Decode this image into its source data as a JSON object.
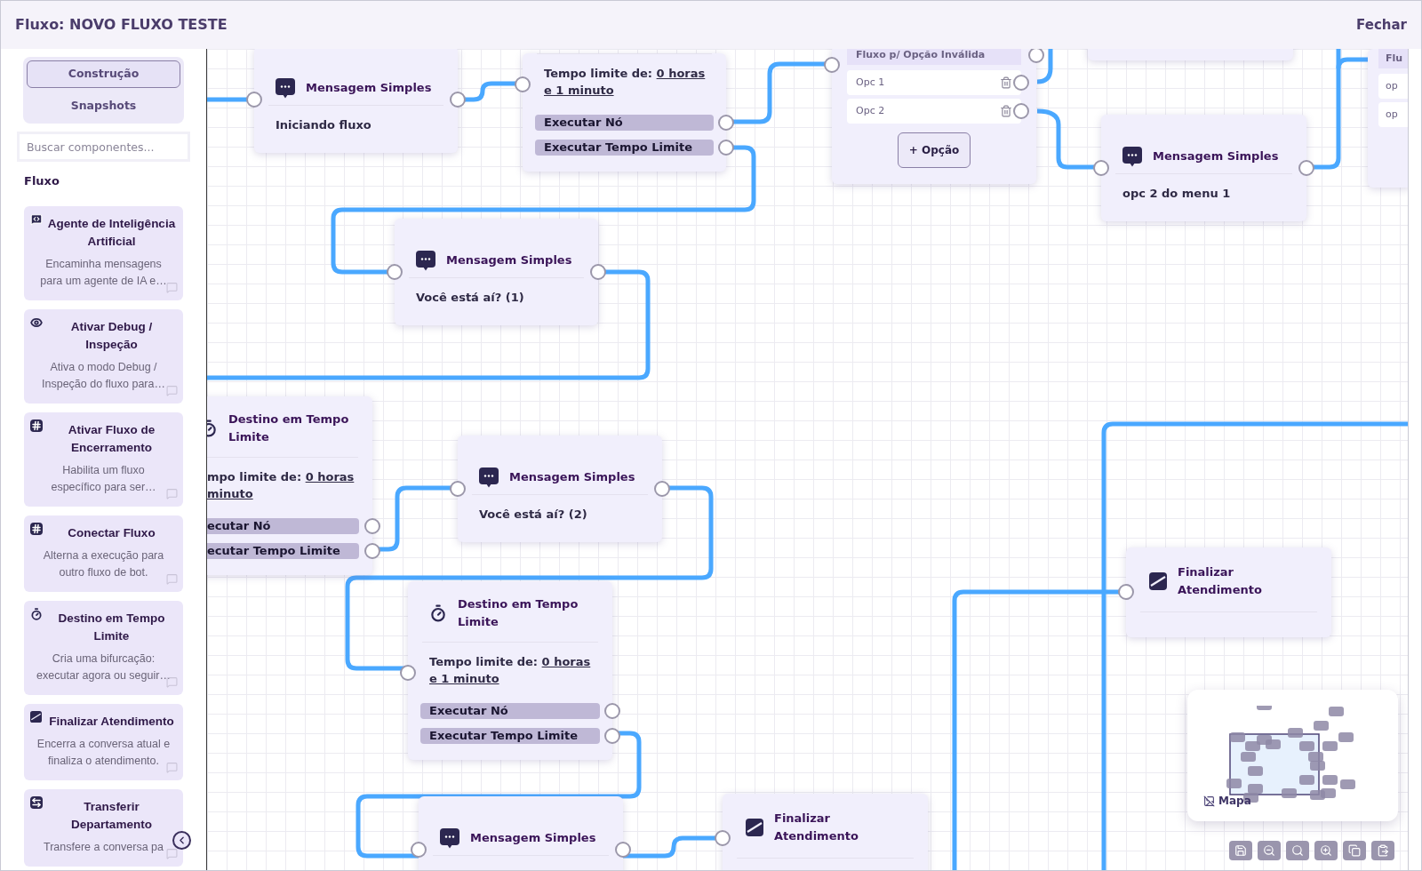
{
  "header": {
    "title": "Fluxo: NOVO FLUXO TESTE",
    "close": "Fechar"
  },
  "sidebar": {
    "tabs": [
      {
        "label": "Construção",
        "selected": true
      },
      {
        "label": "Snapshots",
        "selected": false
      }
    ],
    "search": {
      "placeholder": "Buscar componentes..."
    },
    "section": "Fluxo",
    "components": [
      {
        "kind": "ai",
        "title": "Agente de Inteligência Artificial",
        "description_lines": [
          "Encaminha mensagens",
          "para um agente de IA e…"
        ]
      },
      {
        "kind": "debug",
        "title": "Ativar Debug / Inspeção",
        "description_lines": [
          "Ativa o modo Debug /",
          "Inspeção do fluxo para…"
        ]
      },
      {
        "kind": "flow",
        "title": "Ativar Fluxo de Encerramento",
        "description_lines": [
          "Habilita um fluxo",
          "específico para ser…"
        ]
      },
      {
        "kind": "flow",
        "title": "Conectar Fluxo",
        "description_lines": [
          "Alterna a execução para",
          "outro fluxo de bot."
        ]
      },
      {
        "kind": "timeout",
        "title": "Destino em Tempo Limite",
        "description_lines": [
          "Cria uma bifurcação:",
          "executar agora ou seguir…"
        ]
      },
      {
        "kind": "finalize",
        "title": "Finalizar Atendimento",
        "description_lines": [
          "Encerra a conversa atual e",
          "finaliza o atendimento."
        ]
      },
      {
        "kind": "transfer",
        "title": "Transferir Departamento",
        "description_lines": [
          "Transfere a conversa pa"
        ]
      }
    ]
  },
  "canvas": {
    "nodes": [
      {
        "kind": "message",
        "title": "Mensagem Simples",
        "body": "Iniciando fluxo"
      },
      {
        "kind": "timeout",
        "timeout_label": "Tempo limite de:",
        "timeout_value_lines": [
          "0 horas",
          "e 1 minuto"
        ],
        "outputs": [
          "Executar Nó",
          "Executar Tempo Limite"
        ]
      },
      {
        "kind": "menu",
        "invalid_label": "Fluxo p/ Opção Inválida",
        "options": [
          "Opc 1",
          "Opc 2"
        ],
        "add_button": "+ Opção"
      },
      {
        "kind": "blank"
      },
      {
        "kind": "menu",
        "invalid_label": "Flu",
        "options": [
          "op",
          "op"
        ]
      },
      {
        "kind": "message",
        "title": "Mensagem Simples",
        "body": "opc 2 do menu 1"
      },
      {
        "kind": "message",
        "title": "Mensagem Simples",
        "body": "Você está aí? (1)"
      },
      {
        "kind": "timeout",
        "title": "Destino em Tempo Limite",
        "timeout_label": "mpo limite de:",
        "timeout_value_lines": [
          "0 horas",
          "minuto"
        ],
        "outputs": [
          "ecutar Nó",
          "ecutar Tempo Limite"
        ]
      },
      {
        "kind": "message",
        "title": "Mensagem Simples",
        "body": "Você está aí? (2)"
      },
      {
        "kind": "timeout",
        "title": "Destino em Tempo Limite",
        "timeout_label": "Tempo limite de:",
        "timeout_value_lines": [
          "0 horas",
          "e 1 minuto"
        ],
        "outputs": [
          "Executar Nó",
          "Executar Tempo Limite"
        ]
      },
      {
        "kind": "message",
        "title": "Mensagem Simples"
      },
      {
        "kind": "finalize",
        "title": "Finalizar Atendimento"
      },
      {
        "kind": "finalize",
        "title": "Finalizar Atendimento"
      }
    ],
    "minimap": {
      "label": "Mapa"
    }
  }
}
